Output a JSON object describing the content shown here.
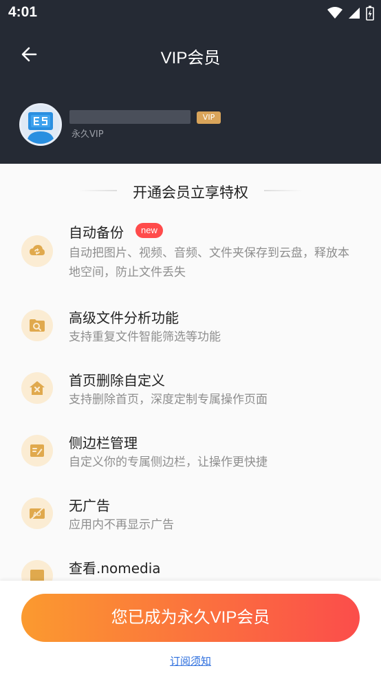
{
  "status_bar": {
    "time": "4:01"
  },
  "header": {
    "title": "VIP会员",
    "vip_badge": "VIP",
    "vip_type": "永久VIP"
  },
  "section_title": "开通会员立享特权",
  "features": [
    {
      "title": "自动备份",
      "badge": "new",
      "desc": "自动把图片、视频、音频、文件夹保存到云盘，释放本地空间，防止文件丢失",
      "icon": "cloud-sync-icon"
    },
    {
      "title": "高级文件分析功能",
      "desc": "支持重复文件智能筛选等功能",
      "icon": "folder-search-icon"
    },
    {
      "title": "首页删除自定义",
      "desc": "支持删除首页，深度定制专属操作页面",
      "icon": "home-delete-icon"
    },
    {
      "title": "侧边栏管理",
      "desc": "自定义你的专属侧边栏，让操作更快捷",
      "icon": "sidebar-edit-icon"
    },
    {
      "title": "无广告",
      "desc": "应用内不再显示广告",
      "icon": "no-ad-icon"
    },
    {
      "title": "查看.nomedia",
      "desc": "",
      "icon": "nomedia-icon"
    }
  ],
  "cta_label": "您已成为永久VIP会员",
  "terms_label": "订阅须知",
  "colors": {
    "header_bg": "#252a34",
    "accent_start": "#fb9a2f",
    "accent_end": "#fb4d4b",
    "icon_bg": "#fbecd3",
    "icon_fg": "#e0a94d",
    "link": "#2e6fde"
  }
}
